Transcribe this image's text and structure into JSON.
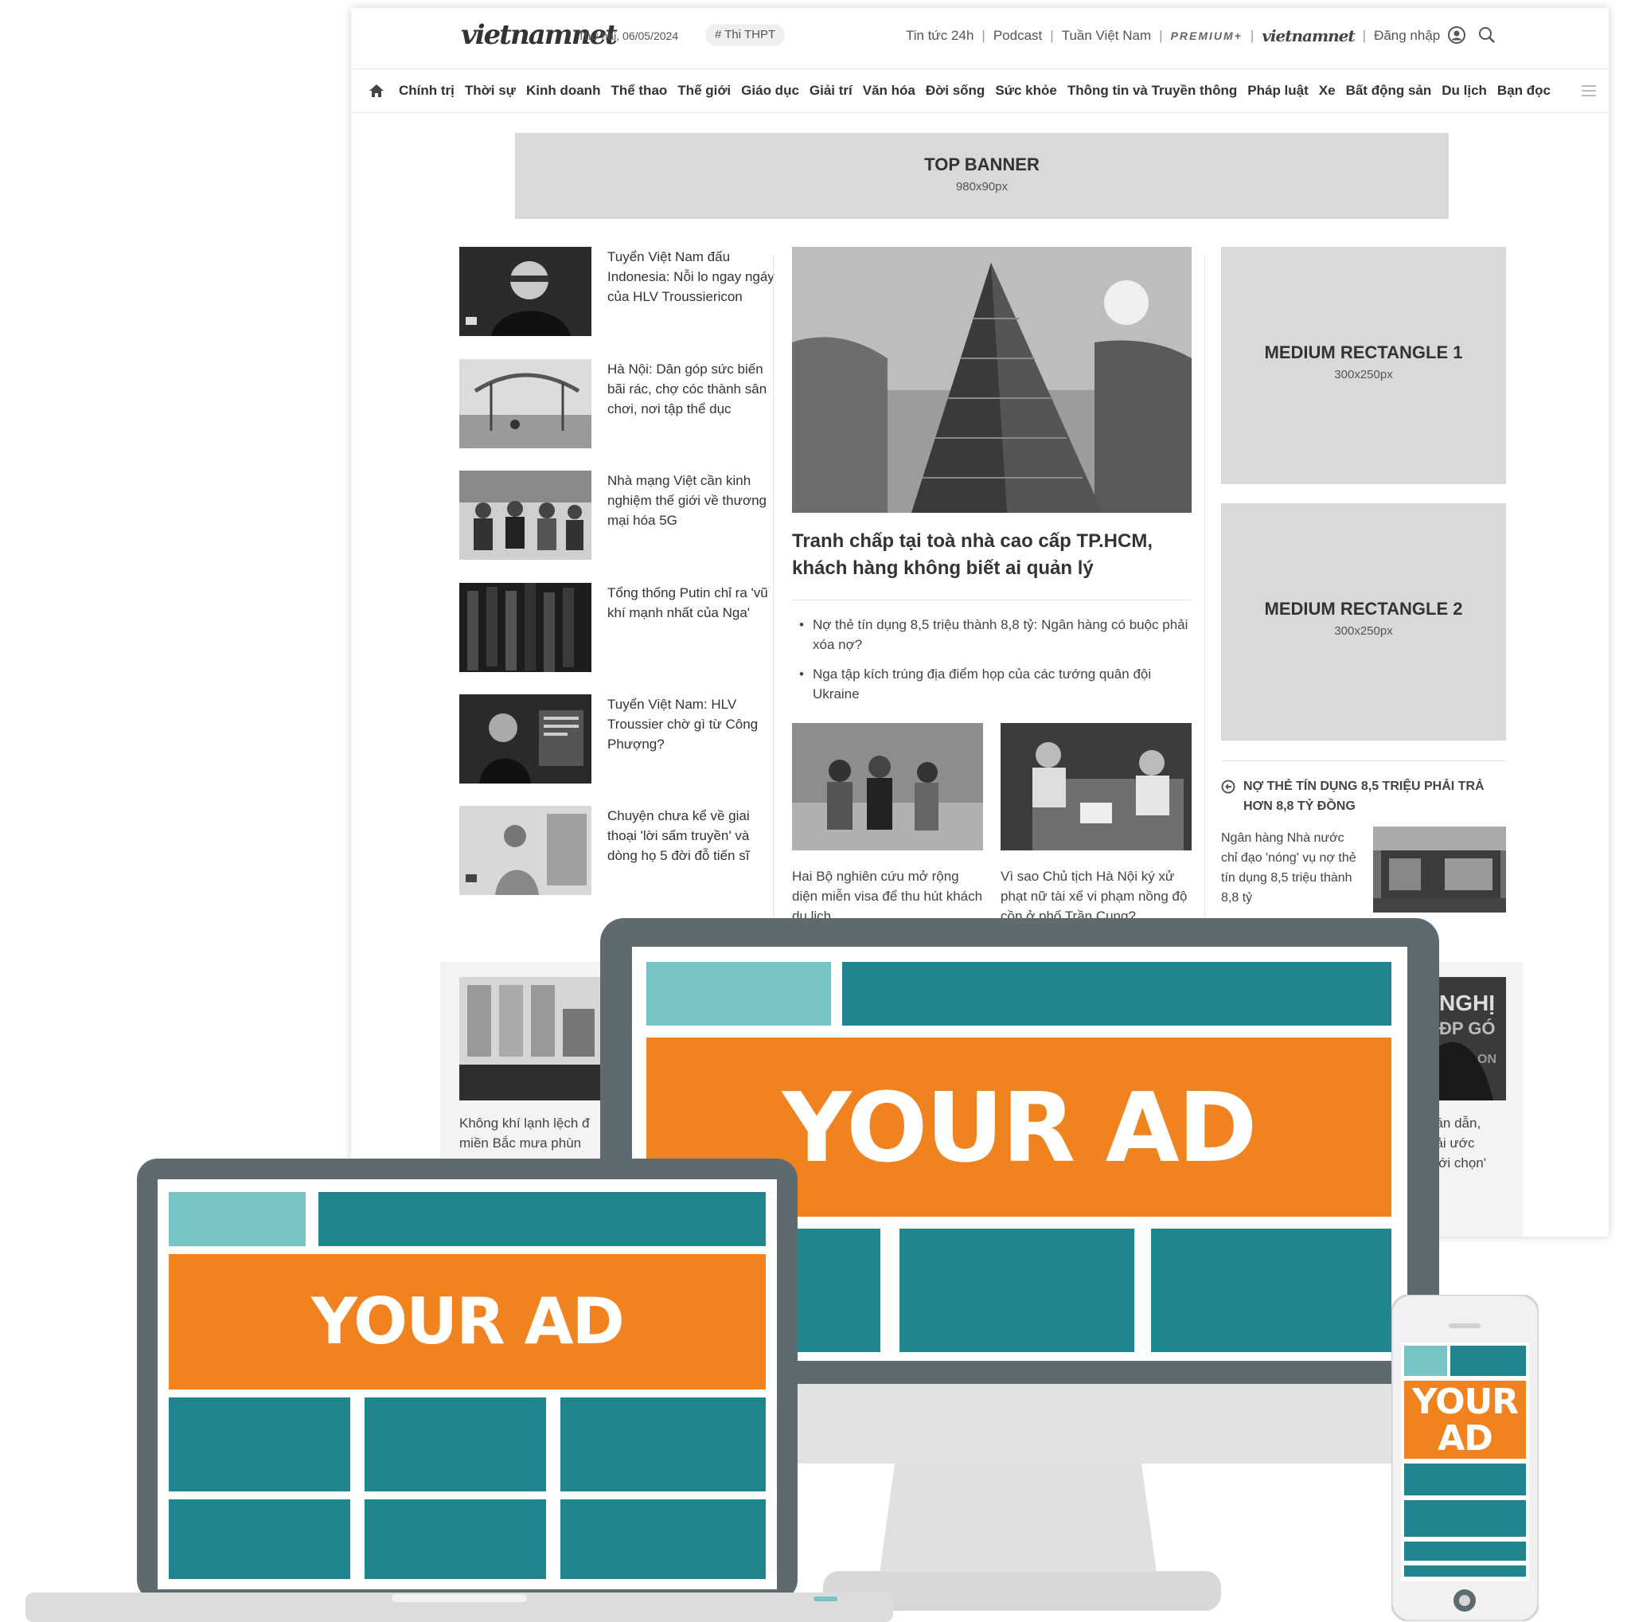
{
  "header": {
    "logo": "vietnamnet",
    "date": "Thứ hai, 06/05/2024",
    "tag": "# Thi THPT",
    "links": [
      "Tin tức 24h",
      "Podcast",
      "Tuần Việt Nam",
      "PREMIUM+",
      "vietnamnet",
      "Đăng nhập"
    ],
    "icons": [
      "user-icon",
      "search-icon"
    ]
  },
  "nav": {
    "home_icon": "home-icon",
    "items": [
      "Chính trị",
      "Thời sự",
      "Kinh doanh",
      "Thể thao",
      "Thế giới",
      "Giáo dục",
      "Giải trí",
      "Văn hóa",
      "Đời sống",
      "Sức khỏe",
      "Thông tin và Truyền thông",
      "Pháp luật",
      "Xe",
      "Bất động sản",
      "Du lịch",
      "Bạn đọc"
    ],
    "menu_icon": "hamburger-icon"
  },
  "top_banner": {
    "title": "TOP BANNER",
    "size": "980x90px"
  },
  "left_list": [
    {
      "title": "Tuyển Việt Nam đấu Indonesia: Nỗi lo ngay ngáy của HLV Troussiericon"
    },
    {
      "title": "Hà Nội: Dân góp sức biến bãi rác, chợ cóc thành sân chơi, nơi tập thể dục"
    },
    {
      "title": "Nhà mạng Việt cần kinh nghiệm thế giới về thương mại hóa 5G"
    },
    {
      "title": "Tổng thống Putin chỉ ra 'vũ khí mạnh nhất của Nga'"
    },
    {
      "title": "Tuyển Việt Nam: HLV Troussier chờ gì từ Công Phượng?"
    },
    {
      "title": "Chuyện chưa kể về giai thoại 'lời sấm truyền' và dòng họ 5 đời đỗ tiến sĩ"
    }
  ],
  "feature": {
    "title": "Tranh chấp tại toà nhà cao cấp TP.HCM, khách hàng không biết ai quản lý",
    "bullets": [
      "Nợ thẻ tín dụng 8,5 triệu thành 8,8 tỷ: Ngân hàng có buộc phải xóa nợ?",
      "Nga tập kích trúng địa điểm họp của các tướng quân đội Ukraine"
    ],
    "sub": [
      {
        "title": "Hai Bộ nghiên cứu mở rộng diện miễn visa để thu hút khách du lịch"
      },
      {
        "title": "Vì sao Chủ tịch Hà Nội ký xử phạt nữ tài xế vi phạm nồng độ cồn ở phố Trần Cung?"
      }
    ]
  },
  "right": {
    "rect1": {
      "title": "MEDIUM RECTANGLE 1",
      "size": "300x250px"
    },
    "rect2": {
      "title": "MEDIUM RECTANGLE 2",
      "size": "300x250px"
    },
    "news_head": "NỢ THẺ TÍN DỤNG 8,5 TRIỆU PHẢI TRẢ HƠN 8,8 TỶ ĐỒNG",
    "news_text": "Ngân hàng Nhà nước chỉ đạo 'nóng' vụ nợ thẻ tín dụng 8,5 triệu thành 8,8 tỷ"
  },
  "bottom_strip": {
    "left_text_1": "Không khí lạnh lệch đ",
    "left_text_2": "miền Bắc mưa phùn",
    "right_text": [
      "bán dẫn,",
      "hải ước",
      "giới chọn'"
    ],
    "right_img_text": [
      "NGHỊ",
      "ĐP GÓ",
      "ON"
    ]
  },
  "devices": {
    "desktop_ad": "YOUR AD",
    "laptop_ad": "YOUR AD",
    "phone_ad_1": "YOUR",
    "phone_ad_2": "AD"
  },
  "colors": {
    "ad_orange": "#f0831f",
    "teal_dark": "#21858f",
    "teal_light": "#76c4c4",
    "frame_gray": "#5d6a70",
    "placeholder_gray": "#d9d9d9"
  }
}
